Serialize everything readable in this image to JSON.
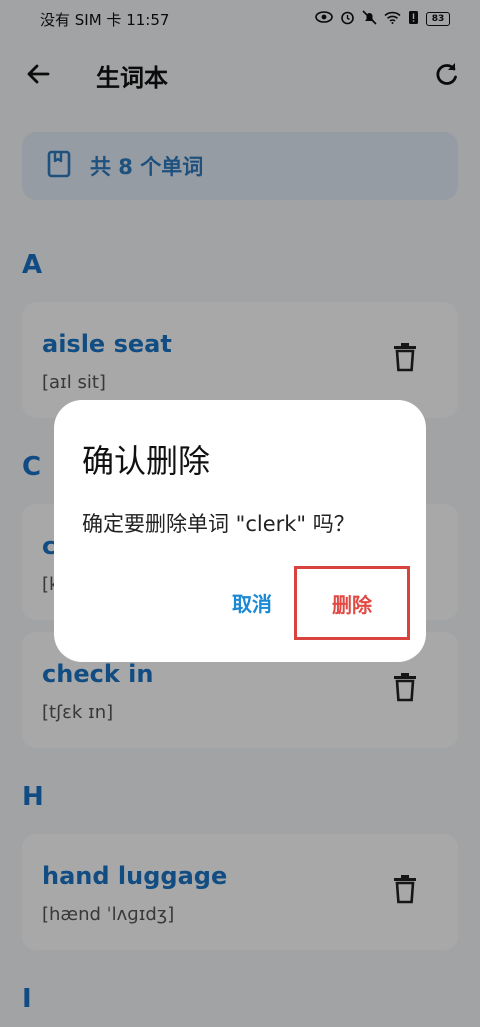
{
  "status_bar": {
    "carrier_time": "没有 SIM 卡 11:57",
    "battery": "83",
    "icons": [
      "eye-icon",
      "alarm-icon",
      "mute-icon",
      "wifi-icon",
      "battery-alert-icon",
      "battery-icon"
    ]
  },
  "header": {
    "title": "生词本",
    "back_icon": "arrow-left-icon",
    "refresh_icon": "refresh-icon"
  },
  "summary": {
    "text": "共 8 个单词",
    "icon": "book-icon"
  },
  "sections": [
    {
      "letter": "A",
      "words": [
        {
          "word": "aisle seat",
          "phonetic": "[aɪl sit]"
        }
      ]
    },
    {
      "letter": "C",
      "words": [
        {
          "word": "clerk",
          "phonetic": "[klɜrk]"
        },
        {
          "word": "check in",
          "phonetic": "[tʃɛk ɪn]"
        }
      ]
    },
    {
      "letter": "H",
      "words": [
        {
          "word": "hand luggage",
          "phonetic": "[hænd ˈlʌɡɪdʒ]"
        }
      ]
    },
    {
      "letter": "I",
      "words": []
    }
  ],
  "dialog": {
    "title": "确认删除",
    "message": "确定要删除单词 \"clerk\" 吗？",
    "cancel_label": "取消",
    "confirm_label": "删除"
  },
  "colors": {
    "accent": "#1b76c6",
    "danger": "#e04a45",
    "banner_bg": "#e3edf8"
  }
}
